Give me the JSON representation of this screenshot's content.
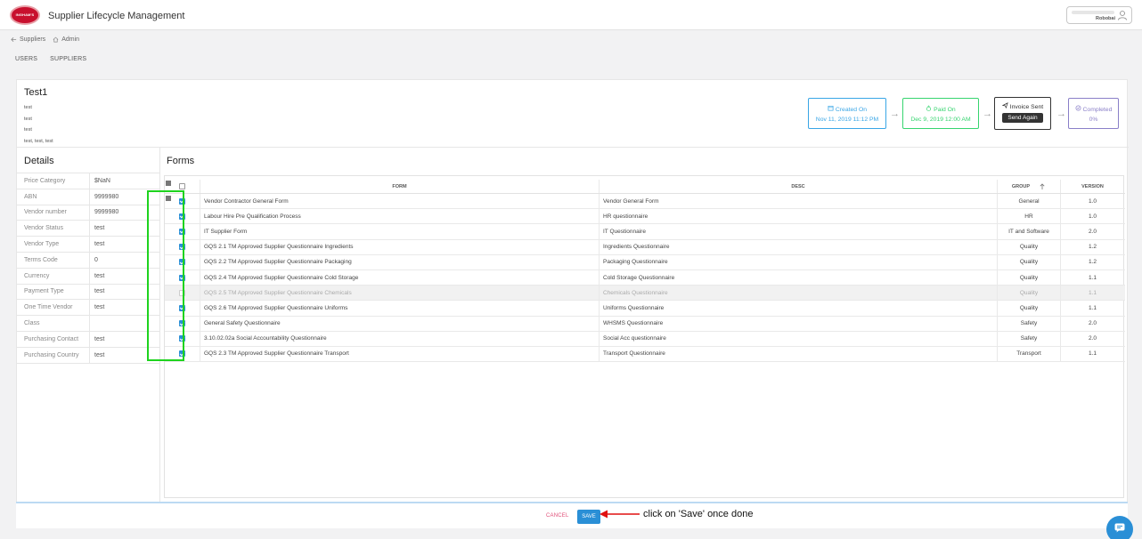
{
  "app": {
    "logo_text": "INGHAM'S",
    "title": "Supplier Lifecycle Management",
    "user_name": "Robobai"
  },
  "breadcrumb": {
    "back_label": "Suppliers",
    "home_label": "Admin"
  },
  "subnav": [
    "USERS",
    "SUPPLIERS"
  ],
  "record": {
    "title": "Test1",
    "lines": [
      "test",
      "test",
      "test",
      "test, test, test"
    ]
  },
  "status_steps": [
    {
      "label": "Created On",
      "sub": "Nov 11, 2019 11:12 PM",
      "color": "#39a6e6"
    },
    {
      "label": "Paid On",
      "sub": "Dec 9, 2019 12:00 AM",
      "color": "#36d46f"
    },
    {
      "label": "Invoice Sent",
      "button": "Send Again",
      "color": "#333333"
    },
    {
      "label": "Completed",
      "sub": "0%",
      "color": "#8a7fc8"
    }
  ],
  "details": {
    "title": "Details",
    "rows": [
      {
        "label": "Price Category",
        "value": "$NaN"
      },
      {
        "label": "ABN",
        "value": "9999980"
      },
      {
        "label": "Vendor number",
        "value": "9999980"
      },
      {
        "label": "Vendor Status",
        "value": "test"
      },
      {
        "label": "Vendor Type",
        "value": "test"
      },
      {
        "label": "Terms Code",
        "value": "0"
      },
      {
        "label": "Currency",
        "value": "test"
      },
      {
        "label": "Payment Type",
        "value": "test"
      },
      {
        "label": "One Time Vendor",
        "value": "test"
      },
      {
        "label": "Class",
        "value": ""
      },
      {
        "label": "Purchasing Contact",
        "value": "test"
      },
      {
        "label": "Purchasing Country",
        "value": "test"
      }
    ]
  },
  "forms": {
    "title": "Forms",
    "columns": {
      "form": "FORM",
      "desc": "DESC",
      "group": "GROUP",
      "version": "VERSION"
    },
    "rows": [
      {
        "form": "Vendor Contractor General Form",
        "desc": "Vendor General Form",
        "group": "General",
        "version": "1.0",
        "checked": true
      },
      {
        "form": "Labour Hire Pre Qualification Process",
        "desc": "HR questionnaire",
        "group": "HR",
        "version": "1.0",
        "checked": true
      },
      {
        "form": "IT Supplier Form",
        "desc": "IT Questionnaire",
        "group": "IT and Software",
        "version": "2.0",
        "checked": true
      },
      {
        "form": "GQS 2.1 TM Approved Supplier Questionnaire Ingredients",
        "desc": "Ingredients Questionnaire",
        "group": "Quality",
        "version": "1.2",
        "checked": true
      },
      {
        "form": "GQS 2.2 TM Approved Supplier Questionnaire Packaging",
        "desc": "Packaging Questionnaire",
        "group": "Quality",
        "version": "1.2",
        "checked": true
      },
      {
        "form": "GQS 2.4 TM Approved Supplier Questionnaire Cold Storage",
        "desc": "Cold Storage Questionnaire",
        "group": "Quality",
        "version": "1.1",
        "checked": true
      },
      {
        "form": "GQS 2.5 TM Approved Supplier Questionnaire Chemicals",
        "desc": "Chemicals Questionnaire",
        "group": "Quality",
        "version": "1.1",
        "checked": false,
        "disabled": true
      },
      {
        "form": "GQS 2.6 TM Approved Supplier Questionnaire Uniforms",
        "desc": "Uniforms Questionnaire",
        "group": "Quality",
        "version": "1.1",
        "checked": true
      },
      {
        "form": "General Safety Questionnaire",
        "desc": "WHSMS Questionnaire",
        "group": "Safety",
        "version": "2.0",
        "checked": true
      },
      {
        "form": "3.10.02.02a Social Accountability Questionnaire",
        "desc": "Social Acc questionnaire",
        "group": "Safety",
        "version": "2.0",
        "checked": true
      },
      {
        "form": "GQS 2.3 TM Approved Supplier Questionnaire Transport",
        "desc": "Transport Questionnaire",
        "group": "Transport",
        "version": "1.1",
        "checked": true
      }
    ]
  },
  "footer": {
    "cancel_label": "CANCEL",
    "save_label": "SAVE"
  },
  "annotation": "click on 'Save' once done"
}
